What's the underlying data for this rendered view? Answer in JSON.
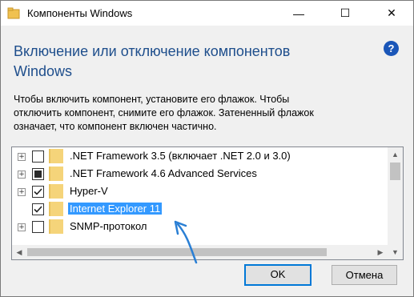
{
  "window": {
    "title": "Компоненты Windows",
    "minimize_glyph": "—",
    "maximize_glyph": "☐",
    "close_glyph": "✕"
  },
  "heading": "Включение или отключение компонентов Windows",
  "help_glyph": "?",
  "description": "Чтобы включить компонент, установите его флажок. Чтобы отключить компонент, снимите его флажок. Затененный флажок означает, что компонент включен частично.",
  "features": [
    {
      "label": ".NET Framework 3.5 (включает .NET 2.0 и 3.0)",
      "state": "unchecked",
      "expandable": true,
      "selected": false
    },
    {
      "label": ".NET Framework 4.6 Advanced Services",
      "state": "partial",
      "expandable": true,
      "selected": false
    },
    {
      "label": "Hyper-V",
      "state": "checked",
      "expandable": true,
      "selected": false
    },
    {
      "label": "Internet Explorer 11",
      "state": "checked",
      "expandable": false,
      "selected": true
    },
    {
      "label": "SNMP-протокол",
      "state": "unchecked",
      "expandable": true,
      "selected": false
    }
  ],
  "expander_glyph": "+",
  "scroll": {
    "up_glyph": "▲",
    "down_glyph": "▼",
    "left_glyph": "◀",
    "right_glyph": "▶"
  },
  "buttons": {
    "ok": "OK",
    "cancel": "Отмена"
  },
  "colors": {
    "heading": "#1e4e8c",
    "selection": "#3399ff",
    "annotation_arrow": "#2a7fd4",
    "default_button_border": "#0078d7"
  }
}
